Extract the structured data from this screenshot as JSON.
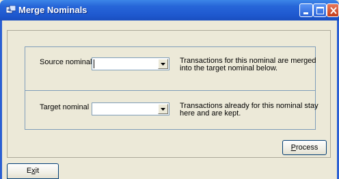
{
  "window": {
    "title": "Merge Nominals",
    "controls": {
      "minimize": "minimize",
      "maximize": "maximize",
      "close": "close"
    }
  },
  "source": {
    "label": "Source nominal",
    "value": "",
    "description_line1": "Transactions for this nominal are merged",
    "description_line2": "into the target nominal below."
  },
  "target": {
    "label": "Target nominal",
    "value": "",
    "description_line1": "Transactions already for this nominal stay",
    "description_line2": "here and are kept."
  },
  "buttons": {
    "process_accel": "P",
    "process_rest": "rocess",
    "exit_first": "E",
    "exit_accel": "x",
    "exit_rest": "it"
  },
  "colors": {
    "titlebar": "#2766d8",
    "window_bg": "#ece9d8",
    "group_border": "#7f9db9",
    "close_button": "#c43d1a"
  },
  "icons": [
    "app-icon",
    "minimize-icon",
    "maximize-icon",
    "close-icon",
    "chevron-down-icon"
  ]
}
